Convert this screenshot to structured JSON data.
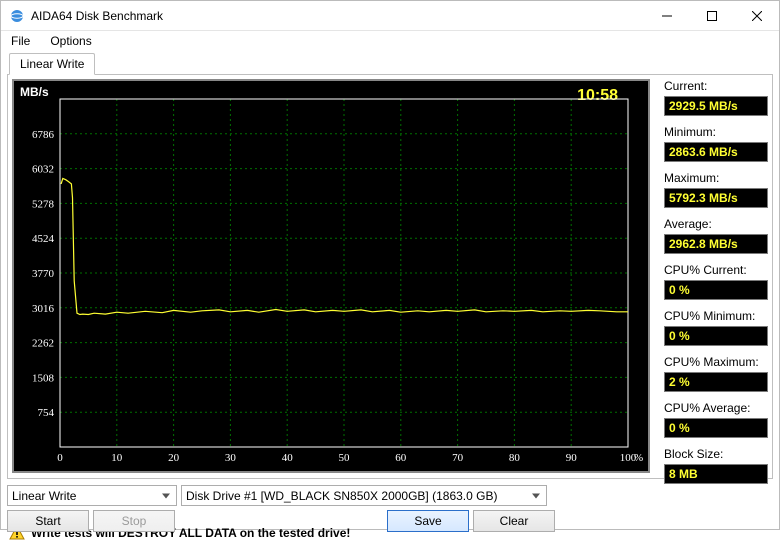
{
  "window": {
    "title": "AIDA64 Disk Benchmark",
    "min_tooltip": "Minimize",
    "max_tooltip": "Maximize",
    "close_tooltip": "Close"
  },
  "menu": {
    "file": "File",
    "options": "Options"
  },
  "tab": {
    "label": "Linear Write"
  },
  "chart_data": {
    "type": "line",
    "xlabel": "%",
    "ylabel": "MB/s",
    "time_label": "10:58",
    "xlim": [
      0,
      100
    ],
    "ylim": [
      0,
      7540
    ],
    "xticks": [
      0,
      10,
      20,
      30,
      40,
      50,
      60,
      70,
      80,
      90,
      100
    ],
    "yticks": [
      754,
      1508,
      2262,
      3016,
      3770,
      4524,
      5278,
      6032,
      6786
    ],
    "series": [
      {
        "name": "Linear Write",
        "color": "#ffff33",
        "x": [
          0.2,
          0.5,
          1.0,
          1.5,
          2.0,
          2.2,
          2.5,
          3.0,
          3.5,
          4.0,
          5,
          6,
          8,
          10,
          12,
          15,
          18,
          20,
          23,
          25,
          28,
          30,
          33,
          35,
          38,
          40,
          43,
          45,
          48,
          50,
          53,
          55,
          58,
          60,
          63,
          65,
          68,
          70,
          73,
          75,
          78,
          80,
          83,
          85,
          88,
          90,
          93,
          95,
          98,
          100
        ],
        "values": [
          5700,
          5820,
          5792,
          5750,
          5700,
          5400,
          3600,
          2900,
          2870,
          2880,
          2870,
          2900,
          2880,
          2920,
          2900,
          2940,
          2910,
          2960,
          2920,
          2950,
          2970,
          2930,
          2960,
          2920,
          2980,
          2940,
          2970,
          2930,
          2960,
          2940,
          2970,
          2930,
          2960,
          2920,
          2950,
          2930,
          2960,
          2940,
          2970,
          2930,
          2950,
          2940,
          2960,
          2930,
          2950,
          2940,
          2960,
          2950,
          2930,
          2929
        ]
      }
    ]
  },
  "stats": {
    "current": {
      "label": "Current:",
      "value": "2929.5 MB/s"
    },
    "minimum": {
      "label": "Minimum:",
      "value": "2863.6 MB/s"
    },
    "maximum": {
      "label": "Maximum:",
      "value": "5792.3 MB/s"
    },
    "average": {
      "label": "Average:",
      "value": "2962.8 MB/s"
    },
    "cpu_current": {
      "label": "CPU% Current:",
      "value": "0 %"
    },
    "cpu_minimum": {
      "label": "CPU% Minimum:",
      "value": "0 %"
    },
    "cpu_maximum": {
      "label": "CPU% Maximum:",
      "value": "2 %"
    },
    "cpu_average": {
      "label": "CPU% Average:",
      "value": "0 %"
    },
    "block_size": {
      "label": "Block Size:",
      "value": "8 MB"
    }
  },
  "controls": {
    "test_select": "Linear Write",
    "drive_select": "Disk Drive #1  [WD_BLACK SN850X 2000GB]  (1863.0 GB)",
    "start": "Start",
    "stop": "Stop",
    "save": "Save",
    "clear": "Clear"
  },
  "warning": "Write tests will DESTROY ALL DATA on the tested drive!"
}
